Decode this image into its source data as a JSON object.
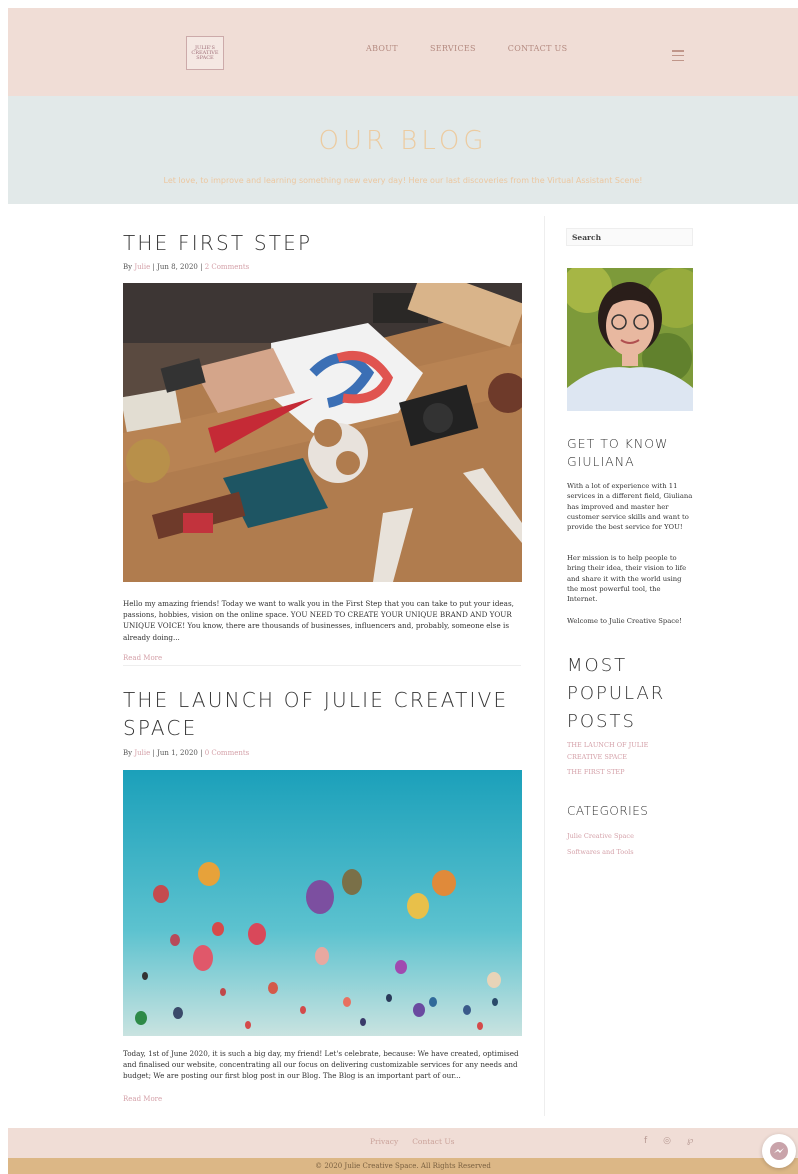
{
  "header": {
    "logo_text": [
      "JULIE'S",
      "CREATIVE",
      "SPACE"
    ],
    "nav": [
      "ABOUT",
      "SERVICES",
      "CONTACT US"
    ]
  },
  "hero": {
    "title": "OUR BLOG",
    "subtitle": "Let love, to improve and learning something new every day! Here our last discoveries from the Virtual Assistant Scene!"
  },
  "posts": [
    {
      "title": "THE FIRST STEP",
      "author": "Julie",
      "date": "Jun 8, 2020",
      "comments": "2 Comments",
      "excerpt": "Hello my amazing friends! Today we want to walk you in the First Step that you can take to put your ideas, passions, hobbies, vision on the online space. YOU NEED TO CREATE YOUR UNIQUE BRAND AND YOUR UNIQUE VOICE! You know, there are thousands of businesses, influencers and, probably, someone else is already doing...",
      "read_more": "Read More"
    },
    {
      "title": "THE LAUNCH OF JULIE CREATIVE SPACE",
      "author": "Julie",
      "date": "Jun 1, 2020",
      "comments": "0 Comments",
      "excerpt": "Today, 1st of June 2020, it is such a big day, my friend! Let's celebrate, because: We have created, optimised and finalised our website, concentrating all our focus on delivering customizable services for any needs and budget; We are posting our first blog post in our Blog. The Blog is an important part of our...",
      "read_more": "Read More"
    }
  ],
  "meta_labels": {
    "by": "By"
  },
  "sidebar": {
    "search_label": "Search",
    "about_heading": "GET TO KNOW GIULIANA",
    "about_text": "With a lot of experience with 11 services in a different field, Giuliana has improved and master her customer service skills and want to provide the best service for YOU!",
    "mission_text": "Her mission is to help people to bring their idea, their vision to life and share it with the world using the most powerful tool, the Internet.",
    "welcome_text": "Welcome to Julie Creative Space!",
    "popular_heading": "MOST POPULAR POSTS",
    "popular_posts": [
      "THE LAUNCH OF JULIE CREATIVE SPACE",
      "THE FIRST STEP"
    ],
    "categories_heading": "CATEGORIES",
    "categories": [
      "Julie Creative Space",
      "Softwares and Tools"
    ]
  },
  "footer": {
    "links": [
      "Privacy",
      "Contact Us"
    ],
    "social_icons": [
      "facebook-icon",
      "instagram-icon",
      "pinterest-icon"
    ],
    "copyright": "© 2020 Julie Creative Space. All Rights Reserved"
  },
  "colors": {
    "header_bg": "#f0ddd6",
    "hero_bg": "#e2e9e9",
    "hero_title": "#eccba0",
    "accent_pink": "#d4a0a8",
    "footer_bar": "#dcb786"
  }
}
